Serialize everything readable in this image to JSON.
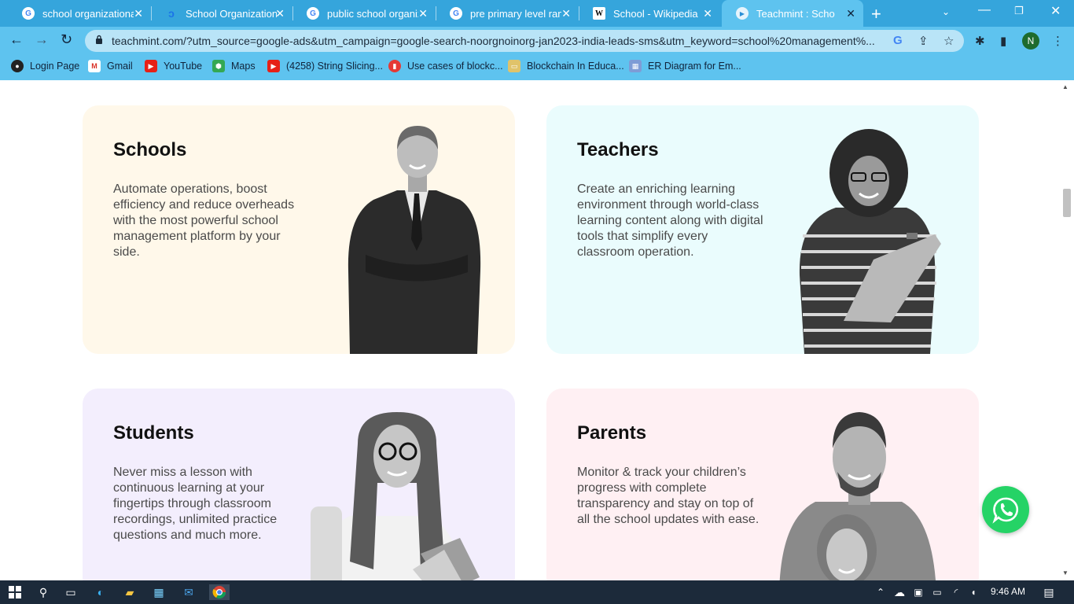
{
  "browser": {
    "tabs": [
      {
        "title": "school organizational",
        "icon": "google-icon"
      },
      {
        "title": "School Organizational",
        "icon": "edge-icon"
      },
      {
        "title": "public school organiza",
        "icon": "google-icon"
      },
      {
        "title": "pre primary level rang",
        "icon": "google-icon"
      },
      {
        "title": "School - Wikipedia",
        "icon": "wikipedia-icon"
      },
      {
        "title": "Teachmint : School LM",
        "icon": "teachmint-icon",
        "active": true
      }
    ],
    "url": "teachmint.com/?utm_source=google-ads&utm_campaign=google-search-noorgnoinorg-jan2023-india-leads-sms&utm_keyword=school%20management%...",
    "profile_initial": "N",
    "bookmarks": [
      {
        "label": "Login Page",
        "icon": "github-icon"
      },
      {
        "label": "Gmail",
        "icon": "gmail-icon"
      },
      {
        "label": "YouTube",
        "icon": "youtube-icon"
      },
      {
        "label": "Maps",
        "icon": "maps-icon"
      },
      {
        "label": "(4258) String Slicing...",
        "icon": "youtube-icon"
      },
      {
        "label": "Use cases of blockc...",
        "icon": "chart-icon"
      },
      {
        "label": "Blockchain In Educa...",
        "icon": "folder-icon"
      },
      {
        "label": "ER Diagram for Em...",
        "icon": "diagram-icon"
      }
    ]
  },
  "cards": [
    {
      "title": "Schools",
      "text": "Automate operations, boost efficiency and reduce overheads with the most powerful school management platform by your side.",
      "bg": "#fff8ea"
    },
    {
      "title": "Teachers",
      "text": "Create an enriching learning environment through world-class learning content along with digital tools that simplify every classroom operation.",
      "bg": "#eafcfd"
    },
    {
      "title": "Students",
      "text": "Never miss a lesson with continuous learning at your fingertips through classroom recordings, unlimited practice questions and much more.",
      "bg": "#f3eefd"
    },
    {
      "title": "Parents",
      "text": "Monitor & track your children’s progress with complete transparency and stay on top of all the school updates with ease.",
      "bg": "#fff0f3"
    }
  ],
  "taskbar": {
    "time": "9:46 AM"
  },
  "colors": {
    "chrome_tabstrip": "#35a5dc",
    "chrome_toolbar": "#5ec3ef",
    "whatsapp": "#25d366",
    "taskbar": "#1c2a3a"
  }
}
